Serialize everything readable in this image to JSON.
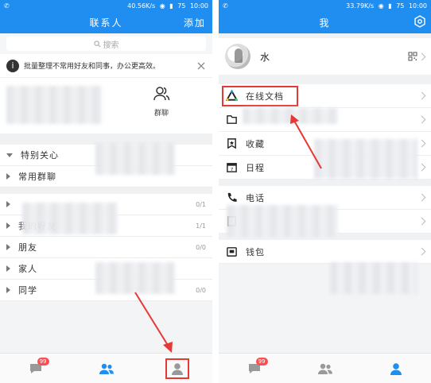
{
  "left": {
    "status": {
      "left": "✆",
      "speed": "40.56K/s",
      "battery": "75",
      "time": "10:00"
    },
    "title": "联系人",
    "action": "添加",
    "search_placeholder": "搜索",
    "notice": "批量整理不常用好友和同事，办公更高效。",
    "group_chat_label": "群聊",
    "groups": [
      {
        "label": "特别关心",
        "count": "",
        "expanded": true
      },
      {
        "label": "常用群聊",
        "count": "",
        "expanded": false
      },
      {
        "label": "",
        "count": "0/1",
        "expanded": false
      },
      {
        "label": "我的好友",
        "count": "1/1",
        "expanded": false
      },
      {
        "label": "朋友",
        "count": "0/0",
        "expanded": false
      },
      {
        "label": "家人",
        "count": "",
        "expanded": false
      },
      {
        "label": "同学",
        "count": "0/0",
        "expanded": false
      }
    ],
    "badge": "99"
  },
  "right": {
    "status": {
      "left": "✆",
      "speed": "33.79K/s",
      "battery": "75",
      "time": "10:00"
    },
    "title": "我",
    "profile_name": "水",
    "menu": [
      {
        "label": "在线文档",
        "icon": "triangle-logo-icon"
      },
      {
        "label": "",
        "icon": "folder-icon"
      },
      {
        "label": "收藏",
        "icon": "bookmark-icon"
      },
      {
        "label": "日程",
        "icon": "calendar-icon"
      },
      {
        "label": "电话",
        "icon": "phone-icon"
      },
      {
        "label": "",
        "icon": "doc-icon"
      },
      {
        "label": "钱包",
        "icon": "wallet-icon"
      }
    ],
    "badge": "99"
  },
  "colors": {
    "accent": "#1f8ef0",
    "highlight": "#e53935"
  }
}
